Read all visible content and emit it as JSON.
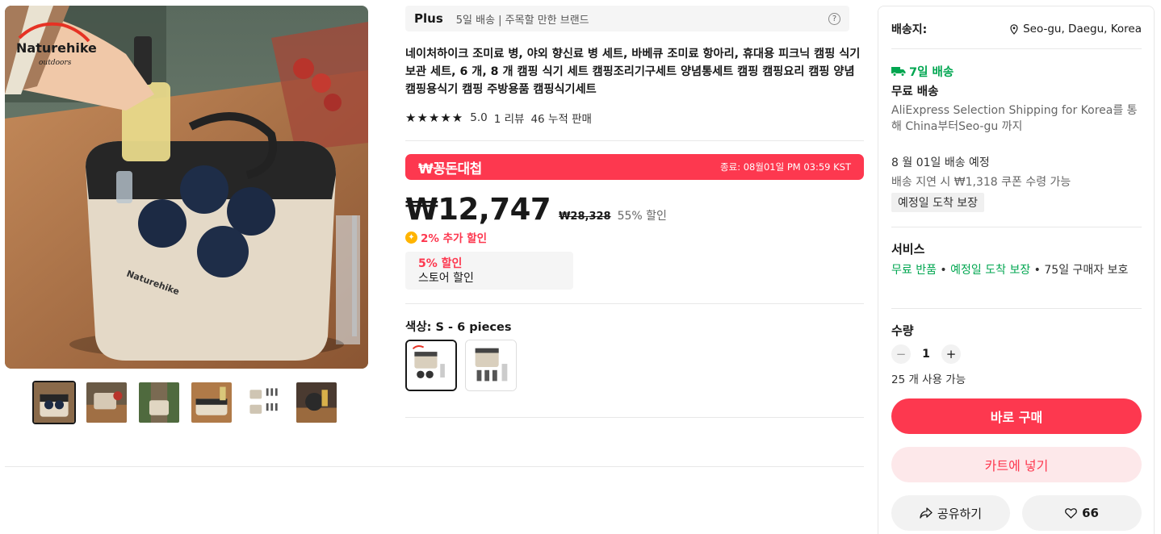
{
  "brand": {
    "logo_text": "Naturehike",
    "logo_sub": "outdoors"
  },
  "gallery": {
    "thumbnail_count": 6,
    "active_index": 0
  },
  "plus_bar": {
    "label": "Plus",
    "text": "5일 배송 | 주목할 만한 브랜드",
    "help": "?"
  },
  "product": {
    "title": "네이처하이크 조미료 병, 야외 향신료 병 세트, 바베큐 조미료 항아리, 휴대용 피크닉 캠핑 식기 보관 세트, 6 개, 8 개 캠핑 식기 세트 캠핑조리기구세트 양념통세트 캠핑 캠핑요리 캠핑 양념 캠핑용식기 캠핑 주방용품 캠핑식기세트",
    "stars": "★★★★★",
    "rating": "5.0",
    "reviews": "1 리뷰",
    "sold": "46 누적 판매"
  },
  "deal": {
    "name": "₩꽁돈대첩",
    "end": "종료: 08월01일 PM 03:59 KST",
    "color": "#fd384f"
  },
  "price": {
    "current": "₩12,747",
    "original": "₩28,328",
    "discount": "55% 할인",
    "extra": "2% 추가 할인"
  },
  "store_coupon": {
    "percent": "5% 할인",
    "label": "스토어 할인"
  },
  "color": {
    "label": "색상: S - 6 pieces",
    "options_count": 2,
    "selected": 0
  },
  "shipping": {
    "label": "배송지:",
    "location": "Seo-gu, Daegu, Korea",
    "days": "7일 배송",
    "free": "무료 배송",
    "route": "AliExpress Selection Shipping for Korea를 통해 China부터Seo-gu 까지",
    "eta": "8 월 01일 배송 예정",
    "delay": "배송 지연 시 ₩1,318 쿠폰 수령 가능",
    "guarantee": "예정일 도착 보장",
    "accent": "#00a650"
  },
  "service": {
    "title": "서비스",
    "free_return": "무료 반품",
    "sep1": " • ",
    "on_time": "예정일 도착 보장",
    "rest": " • 75일 구매자 보호"
  },
  "quantity": {
    "title": "수량",
    "minus": "−",
    "value": "1",
    "plus": "+",
    "stock": "25 개 사용 가능"
  },
  "actions": {
    "buy": "바로 구매",
    "cart": "카트에 넣기",
    "share": "공유하기",
    "likes": "66"
  }
}
